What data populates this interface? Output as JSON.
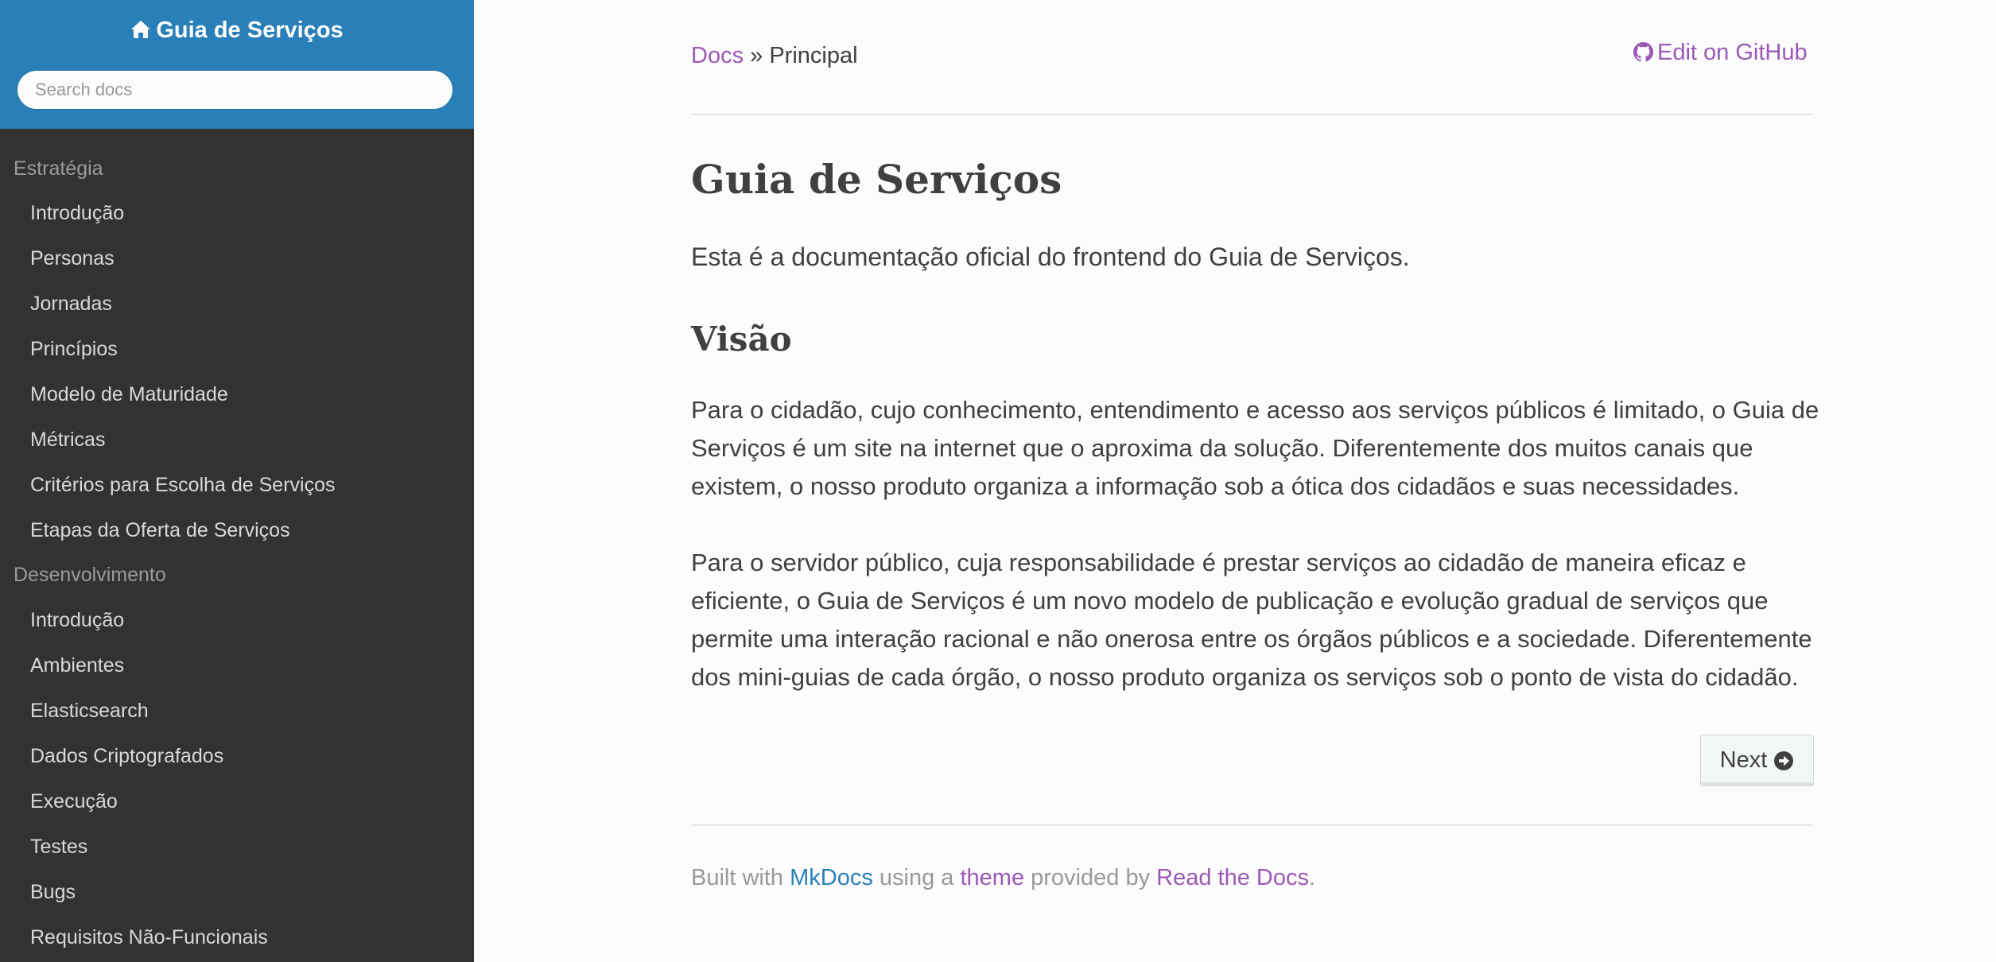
{
  "sidebar": {
    "site_title": "Guia de Serviços",
    "search_placeholder": "Search docs",
    "sections": [
      {
        "caption": "Estratégia",
        "items": [
          "Introdução",
          "Personas",
          "Jornadas",
          "Princípios",
          "Modelo de Maturidade",
          "Métricas",
          "Critérios para Escolha de Serviços",
          "Etapas da Oferta de Serviços"
        ]
      },
      {
        "caption": "Desenvolvimento",
        "items": [
          "Introdução",
          "Ambientes",
          "Elasticsearch",
          "Dados Criptografados",
          "Execução",
          "Testes",
          "Bugs",
          "Requisitos Não-Funcionais"
        ]
      }
    ]
  },
  "breadcrumb": {
    "root": "Docs",
    "separator": " » ",
    "current": "Principal"
  },
  "edit_link": "Edit on GitHub",
  "content": {
    "title": "Guia de Serviços",
    "intro": "Esta é a documentação oficial do frontend do Guia de Serviços.",
    "section_title": "Visão",
    "paragraphs": [
      "Para o cidadão, cujo conhecimento, entendimento e acesso aos serviços públicos é limitado, o Guia de Serviços é um site na internet que o aproxima da solução. Diferentemente dos muitos canais que existem, o nosso produto organiza a informação sob a ótica dos cidadãos e suas necessidades.",
      "Para o servidor público, cuja responsabilidade é prestar serviços ao cidadão de maneira eficaz e eficiente, o Guia de Serviços é um novo modelo de publicação e evolução gradual de serviços que permite uma interação racional e não onerosa entre os órgãos públicos e a sociedade. Diferentemente dos mini-guias de cada órgão, o nosso produto organiza os serviços sob o ponto de vista do cidadão."
    ]
  },
  "next_button": "Next",
  "footer": {
    "prefix": "Built with ",
    "mkdocs": "MkDocs",
    "middle": " using a ",
    "theme": "theme",
    "provided": " provided by ",
    "rtd": "Read the Docs",
    "suffix": "."
  },
  "colors": {
    "sidebar_header": "#2980b9",
    "sidebar_bg": "#343131",
    "link_purple": "#9b59b6",
    "link_blue": "#2980b9",
    "text": "#404040"
  }
}
